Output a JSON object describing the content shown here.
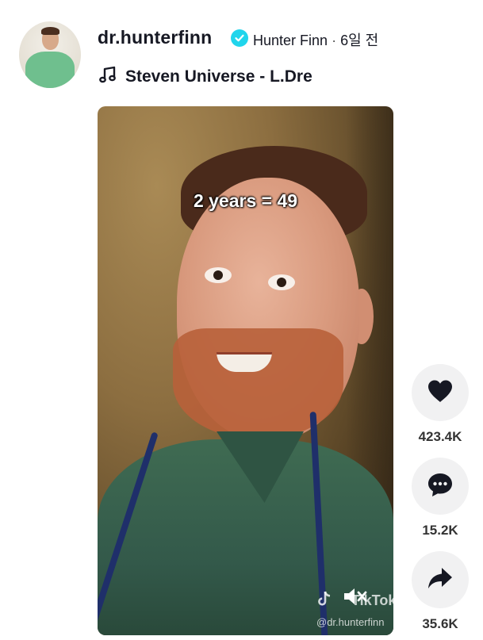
{
  "post": {
    "username": "dr.hunterfinn",
    "display_name": "Hunter Finn",
    "separator": "·",
    "time_ago": "6일 전",
    "music_title": "Steven Universe - L.Dre"
  },
  "video": {
    "overlay_text": "2 years = 49",
    "watermark_brand": "TikTok",
    "watermark_handle": "@dr.hunterfinn"
  },
  "actions": {
    "likes": "423.4K",
    "comments": "15.2K",
    "shares": "35.6K"
  },
  "colors": {
    "verified_badge": "#20d5ec",
    "action_bg": "#f1f1f2",
    "text_primary": "#161823"
  },
  "icons": [
    "verified-icon",
    "music-note-icon",
    "heart-icon",
    "comment-icon",
    "share-icon",
    "mute-icon",
    "tiktok-logo-icon"
  ]
}
